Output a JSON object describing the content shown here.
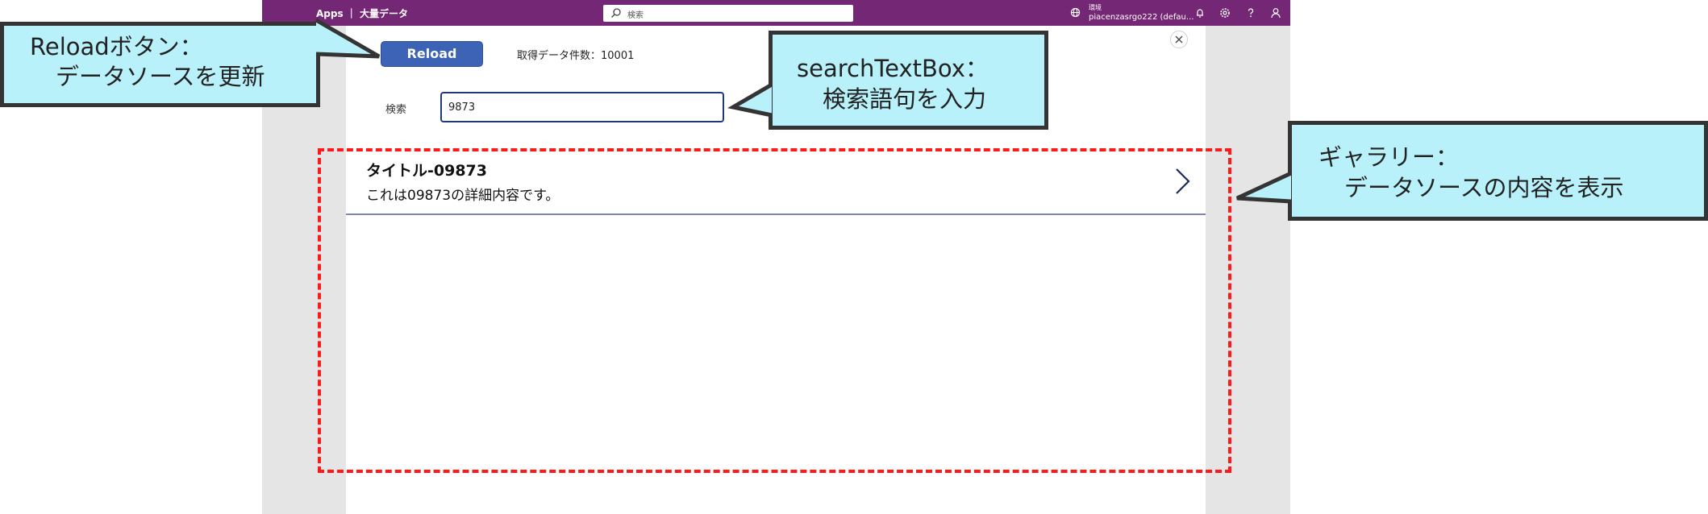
{
  "app": {
    "title": "Apps ｜ 大量データ",
    "search_placeholder": "検索",
    "environment_label": "環境",
    "environment_value": "piacenzasrgo222 (defau..."
  },
  "screen": {
    "reload_label": "Reload",
    "count_label": "取得データ件数：10001",
    "search_label": "検索",
    "search_value": "9873"
  },
  "gallery": {
    "items": [
      {
        "title": "タイトル-09873",
        "subtitle": "これは09873の詳細内容です。"
      }
    ]
  },
  "annotations": {
    "reload": {
      "line1": "Reloadボタン：",
      "line2": "データソースを更新"
    },
    "search": {
      "line1": "searchTextBox：",
      "line2": "検索語句を入力"
    },
    "gallery": {
      "line1": "ギャラリー：",
      "line2": "データソースの内容を表示"
    }
  },
  "colors": {
    "topbar": "#742774",
    "reload_button": "#3c63b6",
    "callout_fill": "#b9f1fb",
    "dashed_frame": "#ff1a1a"
  },
  "icons": [
    "search-icon",
    "environment-icon",
    "bell-icon",
    "gear-icon",
    "help-icon",
    "user-icon",
    "close-icon",
    "chevron-right-icon"
  ]
}
